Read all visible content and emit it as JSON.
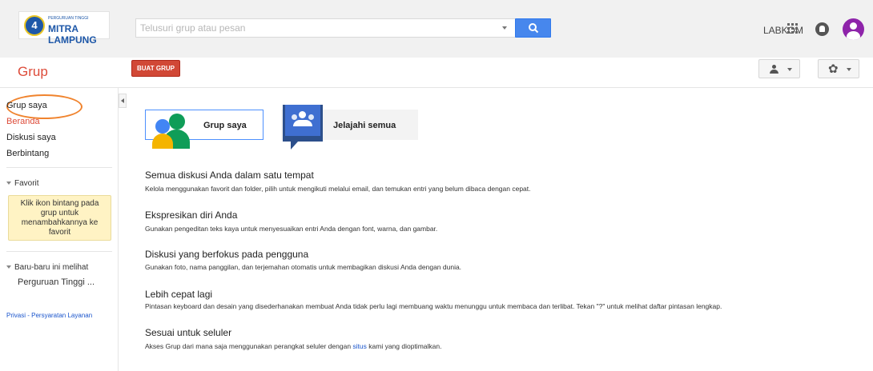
{
  "logo": {
    "small_text": "PERGURUAN TINGGI",
    "big_text": "MITRA LAMPUNG"
  },
  "search": {
    "placeholder": "Telusuri grup atau pesan"
  },
  "user": {
    "label": "LABKOM"
  },
  "header": {
    "title": "Grup",
    "new_group_label": "BUAT GRUP"
  },
  "sidebar": {
    "nav": [
      "Grup saya",
      "Beranda",
      "Diskusi saya",
      "Berbintang"
    ],
    "favorites": {
      "title": "Favorit",
      "hint": "Klik ikon bintang pada grup untuk menambahkannya ke favorit"
    },
    "recent": {
      "title": "Baru-baru ini melihat",
      "items": [
        "Perguruan Tinggi ..."
      ]
    },
    "footer_link": "Privasi - Persyaratan Layanan"
  },
  "cards": {
    "mine": "Grup saya",
    "explore": "Jelajahi semua"
  },
  "features": [
    {
      "heading": "Semua diskusi Anda dalam satu tempat",
      "text": "Kelola menggunakan favorit dan folder, pilih untuk mengikuti melalui email, dan temukan entri yang belum dibaca dengan cepat."
    },
    {
      "heading": "Ekspresikan diri Anda",
      "text": "Gunakan pengeditan teks kaya untuk menyesuaikan entri Anda dengan font, warna, dan gambar."
    },
    {
      "heading": "Diskusi yang berfokus pada pengguna",
      "text": "Gunakan foto, nama panggilan, dan terjemahan otomatis untuk membagikan diskusi Anda dengan dunia."
    },
    {
      "heading": "Lebih cepat lagi",
      "text": "Pintasan keyboard dan desain yang disederhanakan membuat Anda tidak perlu lagi membuang waktu menunggu untuk membaca dan terlibat. Tekan \"?\" untuk melihat daftar pintasan lengkap."
    },
    {
      "heading": "Sesuai untuk seluler",
      "text_before": "Akses Grup dari mana saja menggunakan perangkat seluler dengan ",
      "link": "situs",
      "text_after": " kami yang dioptimalkan."
    }
  ],
  "icons": [
    "search-icon",
    "apps-icon",
    "notifications-icon",
    "account-avatar",
    "people-settings-icon",
    "gear-icon",
    "collapse-sidebar-icon"
  ],
  "colors": {
    "brand_red": "#dd4b39",
    "button_red": "#d14836",
    "search_blue": "#4787ed",
    "link_blue": "#1a55cc",
    "highlight_oval": "#f0832d"
  }
}
